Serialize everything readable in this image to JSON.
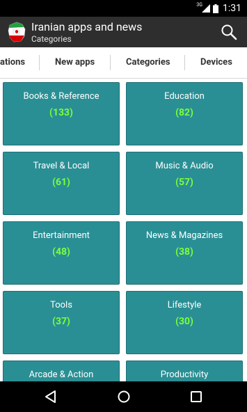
{
  "status_bar": {
    "network_type": "3G",
    "time": "1:31"
  },
  "action_bar": {
    "title": "Iranian apps and news",
    "subtitle": "Categories",
    "icons": {
      "app": "iran-flag-map-icon",
      "search": "search-icon"
    }
  },
  "tabs": [
    {
      "label": "ations"
    },
    {
      "label": "New apps"
    },
    {
      "label": "Categories"
    },
    {
      "label": "Devices"
    }
  ],
  "categories": [
    {
      "name": "Books & Reference",
      "count": "(133)"
    },
    {
      "name": "Education",
      "count": "(82)"
    },
    {
      "name": "Travel & Local",
      "count": "(61)"
    },
    {
      "name": "Music & Audio",
      "count": "(57)"
    },
    {
      "name": "Entertainment",
      "count": "(48)"
    },
    {
      "name": "News & Magazines",
      "count": "(38)"
    },
    {
      "name": "Tools",
      "count": "(37)"
    },
    {
      "name": "Lifestyle",
      "count": "(30)"
    },
    {
      "name": "Arcade & Action",
      "count": ""
    },
    {
      "name": "Productivity",
      "count": ""
    }
  ],
  "colors": {
    "tile_background": "#2a8f94",
    "count_text": "#7cff3b",
    "action_bar": "#2e2e2e"
  },
  "nav_bar": {
    "icons": [
      "back-icon",
      "home-icon",
      "recents-icon"
    ]
  }
}
